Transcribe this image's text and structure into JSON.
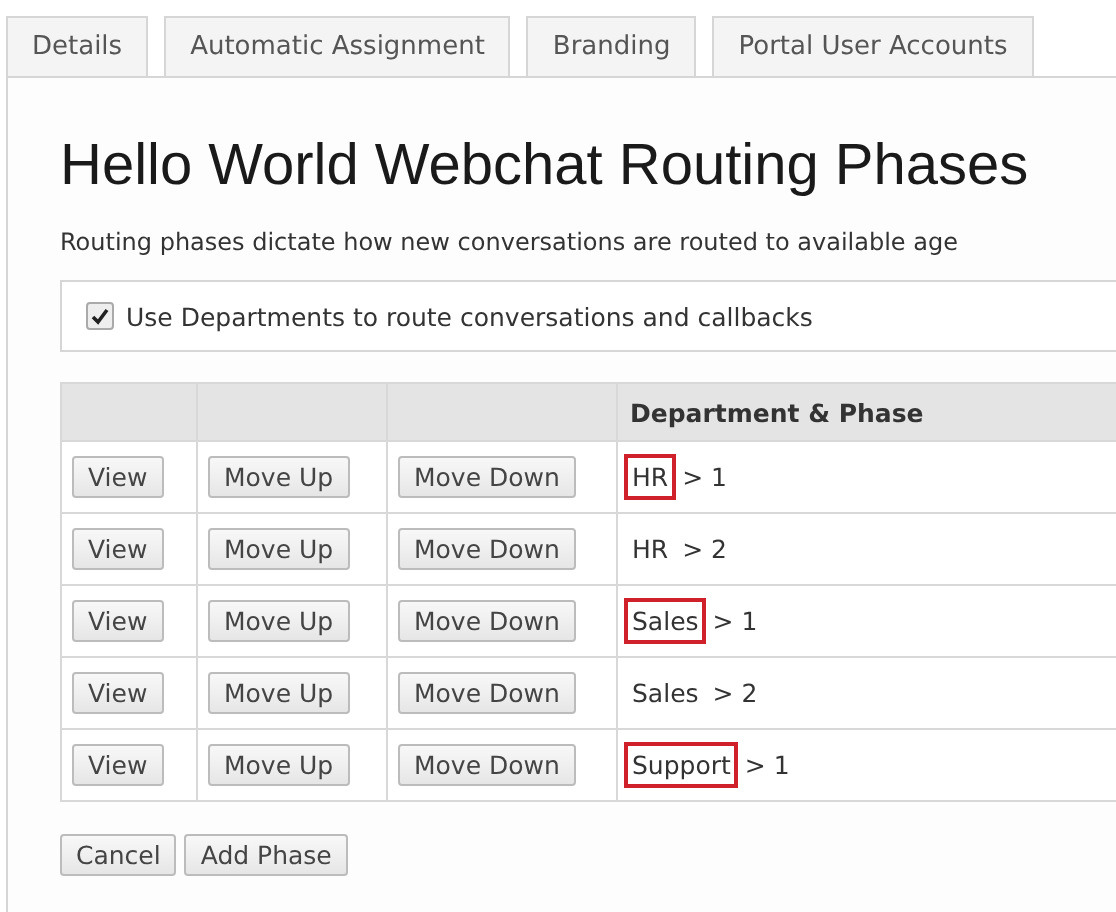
{
  "tabs": [
    {
      "label": "Details",
      "selected": false
    },
    {
      "label": "Automatic Assignment",
      "selected": false
    },
    {
      "label": "Branding",
      "selected": false
    },
    {
      "label": "Portal User Accounts",
      "selected": false
    }
  ],
  "title": "Hello World Webchat Routing Phases",
  "description": "Routing phases dictate how new conversations are routed to available age",
  "use_departments": {
    "label": "Use Departments to route conversations and callbacks",
    "checked": true
  },
  "table": {
    "columns": [
      "Department & Phase"
    ],
    "rows": [
      {
        "buttons": [
          "View",
          "Move Up",
          "Move Down"
        ],
        "department": "HR",
        "phase": "> 1",
        "highlighted": true
      },
      {
        "buttons": [
          "View",
          "Move Up",
          "Move Down"
        ],
        "department": "HR",
        "phase": "> 2",
        "highlighted": false
      },
      {
        "buttons": [
          "View",
          "Move Up",
          "Move Down"
        ],
        "department": "Sales",
        "phase": "> 1",
        "highlighted": true
      },
      {
        "buttons": [
          "View",
          "Move Up",
          "Move Down"
        ],
        "department": "Sales",
        "phase": "> 2",
        "highlighted": false
      },
      {
        "buttons": [
          "View",
          "Move Up",
          "Move Down"
        ],
        "department": "Support",
        "phase": "> 1",
        "highlighted": true
      }
    ]
  },
  "footer_buttons": [
    "Cancel",
    "Add Phase"
  ]
}
